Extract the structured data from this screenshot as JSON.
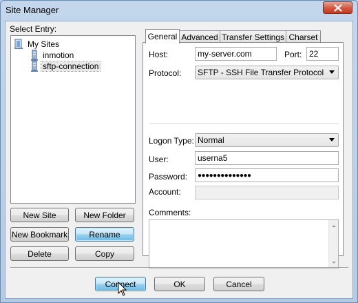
{
  "window": {
    "title": "Site Manager"
  },
  "tree": {
    "label": "Select Entry:",
    "root": "My Sites",
    "items": [
      {
        "label": "inmotion"
      },
      {
        "label": "sftp-connection",
        "selected": true
      }
    ]
  },
  "left_buttons": {
    "new_site": "New Site",
    "new_folder": "New Folder",
    "new_bookmark": "New Bookmark",
    "rename": "Rename",
    "delete": "Delete",
    "copy": "Copy"
  },
  "tabs": [
    "General",
    "Advanced",
    "Transfer Settings",
    "Charset"
  ],
  "general": {
    "host_label": "Host:",
    "host_value": "my-server.com",
    "port_label": "Port:",
    "port_value": "22",
    "protocol_label": "Protocol:",
    "protocol_value": "SFTP - SSH File Transfer Protocol",
    "logon_label": "Logon Type:",
    "logon_value": "Normal",
    "user_label": "User:",
    "user_value": "userna5",
    "password_label": "Password:",
    "password_value": "●●●●●●●●●●●●●●",
    "account_label": "Account:",
    "account_value": "",
    "comments_label": "Comments:"
  },
  "footer": {
    "connect": "Connect",
    "ok": "OK",
    "cancel": "Cancel"
  }
}
